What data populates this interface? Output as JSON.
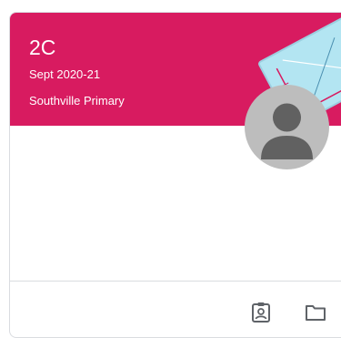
{
  "class_card": {
    "title": "2C",
    "section": "Sept 2020-21",
    "school": "Southville Primary",
    "theme_color": "#d81b60",
    "icons": [
      "teacher-avatar-icon",
      "assignment-ind-icon",
      "folder-icon"
    ]
  }
}
